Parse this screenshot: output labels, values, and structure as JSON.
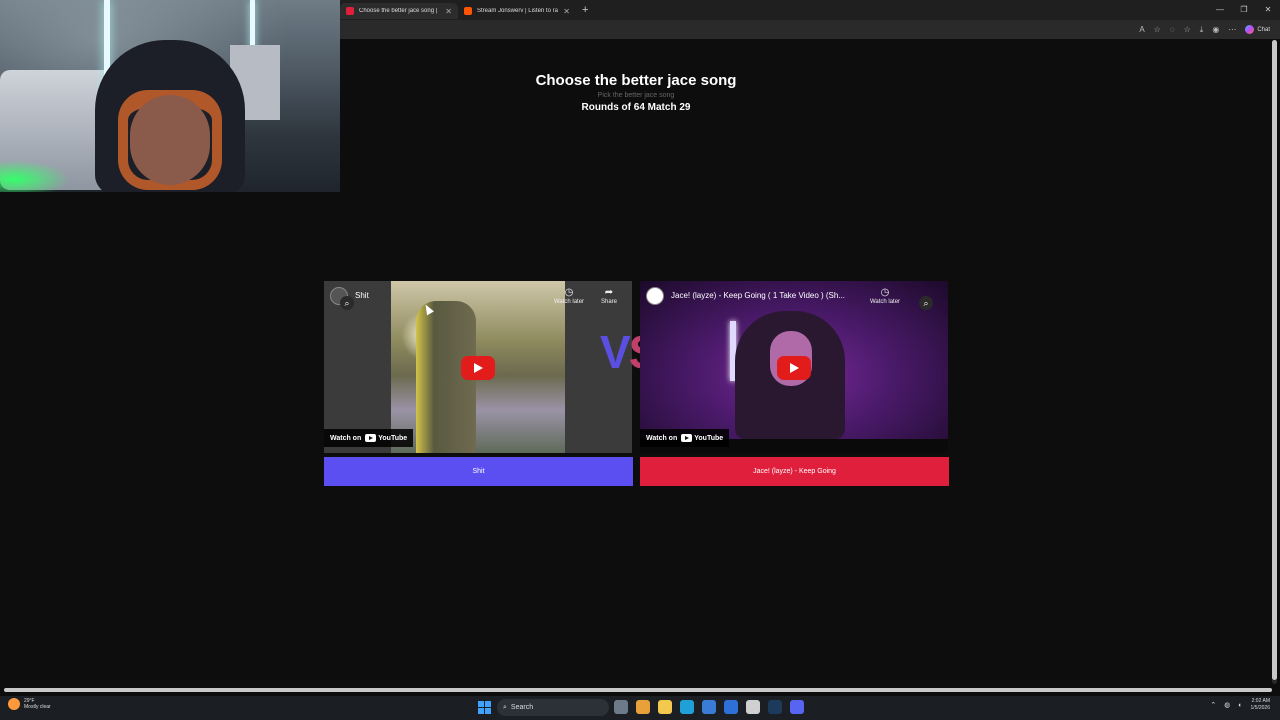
{
  "browser": {
    "tabs": [
      {
        "title": "Choose the better jace song |",
        "active": true,
        "favicon_color": "#e01f3d"
      },
      {
        "title": "Stream Jonswerv | Listen to rap pl",
        "active": false,
        "favicon_color": "#ff5500"
      }
    ],
    "window_controls": [
      "—",
      "❐",
      "✕"
    ],
    "toolbar_icons": [
      "A",
      "☆",
      "◌",
      "☆",
      "⤓",
      "◉",
      "⋯"
    ],
    "copilot_label": "Chat"
  },
  "page": {
    "title": "Choose the better jace song",
    "subtitle": "Pick the better jace song",
    "round_info": "Rounds of 64 Match 29"
  },
  "matchup": {
    "vs_left": "V",
    "vs_right": "S",
    "left": {
      "video_title": "Shit",
      "watch_later": "Watch later",
      "share": "Share",
      "watch_on": "Watch on",
      "yt_label": "YouTube",
      "pick_label": "Shit"
    },
    "right": {
      "video_title": "Jace! (layze) - Keep Going ( 1 Take Video ) (Sh...",
      "watch_later": "Watch later",
      "watch_on": "Watch on",
      "yt_label": "YouTube",
      "pick_label": "Jace! (layze) - Keep Going"
    }
  },
  "colors": {
    "left_button": "#5b4ff2",
    "right_button": "#e01f3d",
    "background": "#0d0d0d"
  },
  "taskbar": {
    "weather_temp": "29°F",
    "weather_desc": "Mostly clear",
    "search_placeholder": "Search",
    "time": "2:02 AM",
    "date": "1/5/2026"
  }
}
